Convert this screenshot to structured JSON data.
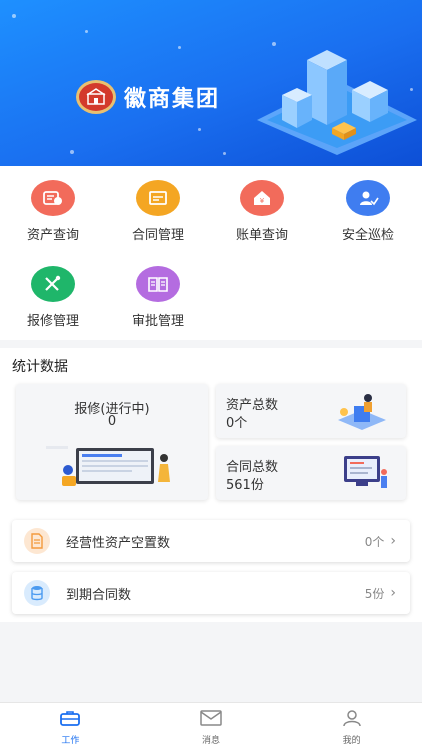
{
  "banner": {
    "brand_name": "徽商集团",
    "logo_icon": "huishang-seal-logo"
  },
  "modules": [
    {
      "label": "资产查询",
      "icon": "asset-icon",
      "color": "#f26b5b"
    },
    {
      "label": "合同管理",
      "icon": "contract-icon",
      "color": "#f4a623"
    },
    {
      "label": "账单查询",
      "icon": "bill-icon",
      "color": "#f26b5b"
    },
    {
      "label": "安全巡检",
      "icon": "inspection-icon",
      "color": "#3f7df0"
    },
    {
      "label": "报修管理",
      "icon": "repair-icon",
      "color": "#1fb66a"
    },
    {
      "label": "审批管理",
      "icon": "approval-icon",
      "color": "#b46ce0"
    }
  ],
  "stats": {
    "title": "统计数据",
    "repair": {
      "title": "报修(进行中)",
      "value": "0"
    },
    "assets": {
      "title": "资产总数",
      "value": "0个"
    },
    "contracts": {
      "title": "合同总数",
      "value": "561份"
    }
  },
  "rows": [
    {
      "label": "经营性资产空置数",
      "value": "0个",
      "icon": "document-icon",
      "color": "#f9b56a"
    },
    {
      "label": "到期合同数",
      "value": "5份",
      "icon": "database-icon",
      "color": "#4a9af0"
    }
  ],
  "tabbar": [
    {
      "label": "工作",
      "icon": "briefcase-icon"
    },
    {
      "label": "消息",
      "icon": "mail-icon"
    },
    {
      "label": "我的",
      "icon": "person-icon"
    }
  ],
  "colors": {
    "primary": "#1a6ff0"
  }
}
